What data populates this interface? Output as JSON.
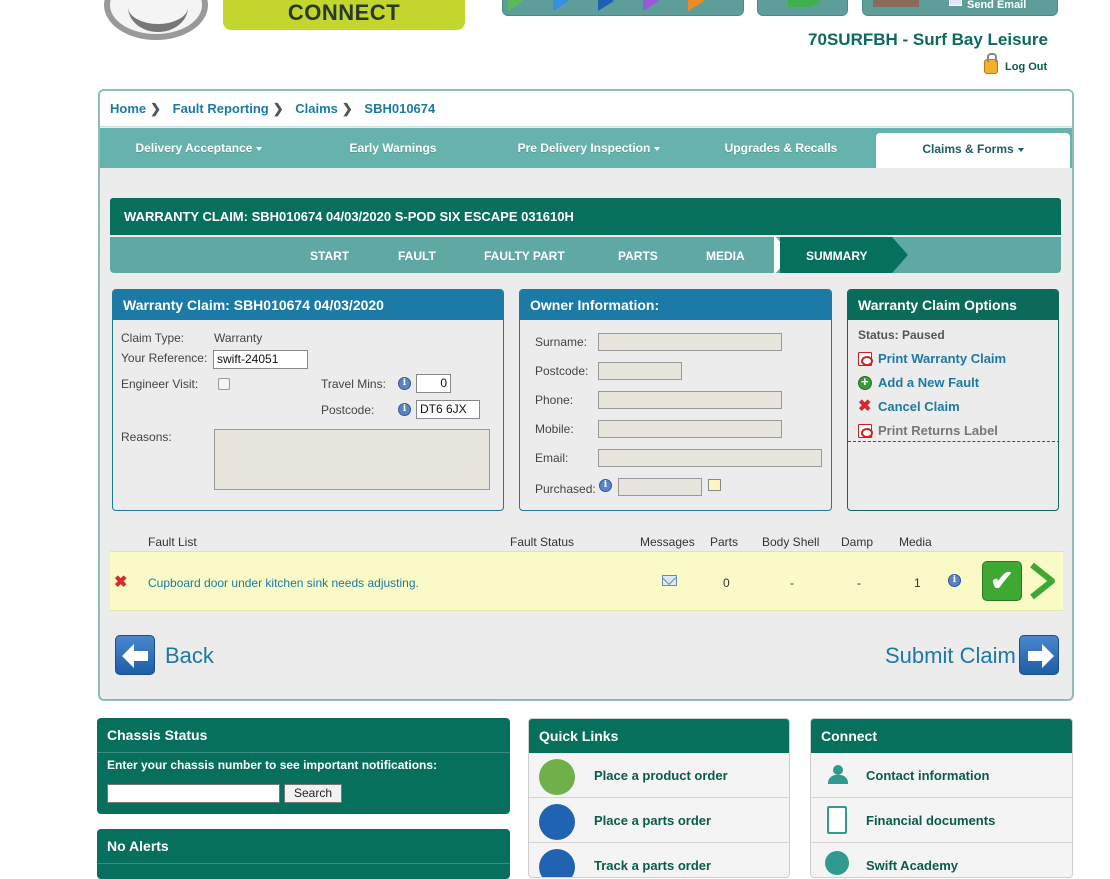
{
  "header": {
    "brand": "CONNECT",
    "send_email": "Send Email",
    "dealer": "70SURFBH - Surf Bay Leisure",
    "logout": "Log Out"
  },
  "breadcrumb": [
    "Home",
    "Fault Reporting",
    "Claims",
    "SBH010674"
  ],
  "tabs": [
    {
      "label": "Delivery Acceptance",
      "dropdown": true
    },
    {
      "label": "Early Warnings",
      "dropdown": false
    },
    {
      "label": "Pre Delivery Inspection",
      "dropdown": true
    },
    {
      "label": "Upgrades & Recalls",
      "dropdown": false
    },
    {
      "label": "Claims & Forms",
      "dropdown": true,
      "active": true
    }
  ],
  "claim_header": "WARRANTY CLAIM: SBH010674 04/03/2020 S-POD SIX ESCAPE 031610H",
  "steps": [
    "START",
    "FAULT",
    "FAULTY PART",
    "PARTS",
    "MEDIA",
    "SUMMARY"
  ],
  "claim_box": {
    "title": "Warranty Claim: SBH010674 04/03/2020",
    "claim_type_label": "Claim Type:",
    "claim_type": "Warranty",
    "reference_label": "Your Reference:",
    "reference": "swift-24051",
    "engineer_label": "Engineer Visit:",
    "travel_label": "Travel Mins:",
    "travel_mins": "0",
    "postcode_label": "Postcode:",
    "postcode": "DT6 6JX",
    "reasons_label": "Reasons:"
  },
  "owner_box": {
    "title": "Owner Information:",
    "surname": "Surname:",
    "postcode": "Postcode:",
    "phone": "Phone:",
    "mobile": "Mobile:",
    "email": "Email:",
    "purchased": "Purchased:"
  },
  "options_box": {
    "title": "Warranty Claim Options",
    "status": "Status: Paused",
    "print_claim": "Print Warranty Claim",
    "add_fault": "Add a New Fault",
    "cancel": "Cancel Claim",
    "print_label": "Print Returns Label"
  },
  "fault_table": {
    "headers": [
      "Fault List",
      "Fault Status",
      "Messages",
      "Parts",
      "Body Shell",
      "Damp",
      "Media"
    ],
    "row": {
      "description": "Cupboard door under kitchen sink needs adjusting.",
      "parts": "0",
      "body_shell": "-",
      "damp": "-",
      "media": "1"
    }
  },
  "actions": {
    "back": "Back",
    "submit": "Submit Claim"
  },
  "chassis": {
    "title": "Chassis Status",
    "prompt": "Enter your chassis number to see important notifications:",
    "search": "Search"
  },
  "alerts": {
    "title": "No Alerts"
  },
  "quick_links": {
    "title": "Quick Links",
    "items": [
      "Place a product order",
      "Place a parts order",
      "Track a parts order"
    ]
  },
  "connect": {
    "title": "Connect",
    "items": [
      "Contact information",
      "Financial documents",
      "Swift Academy"
    ]
  },
  "colors": {
    "teal": "#06705c",
    "blue": "#1b7aa6",
    "row_highlight": "#fafac6"
  }
}
